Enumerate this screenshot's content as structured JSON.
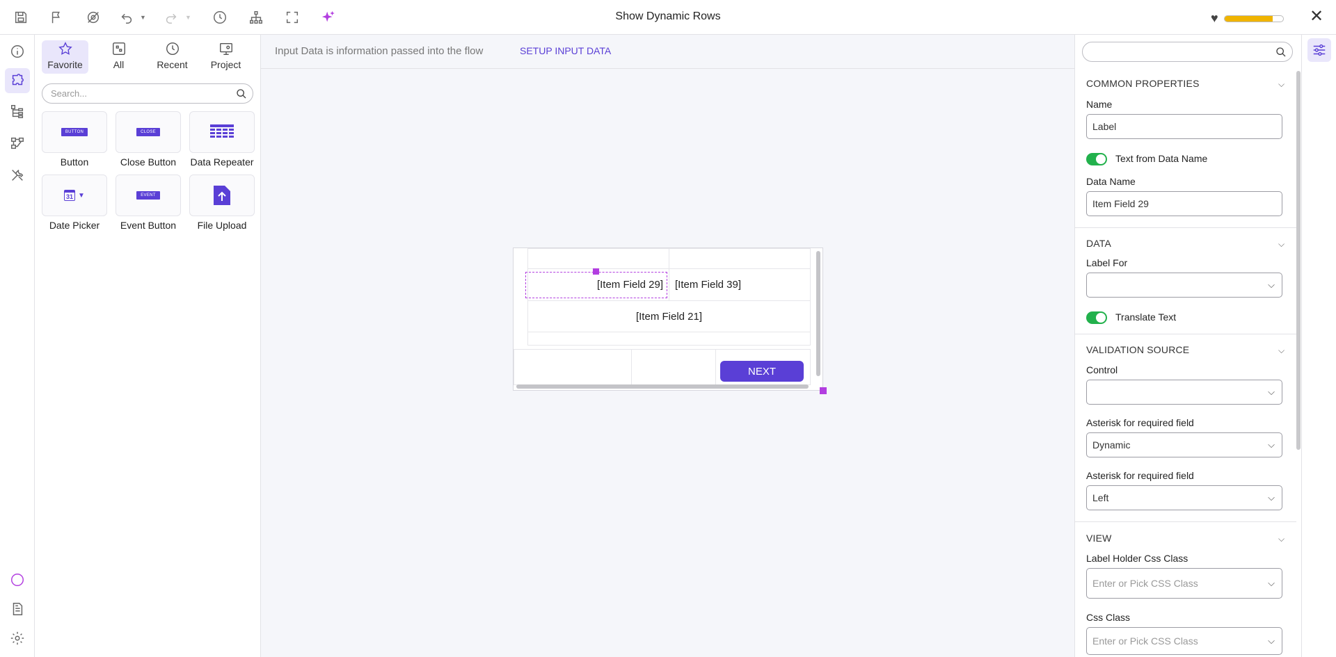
{
  "window": {
    "title": "Show Dynamic Rows"
  },
  "toolbar": {
    "icons": [
      "save-icon",
      "flag-icon",
      "settings-off-icon",
      "undo-icon",
      "redo-icon",
      "history-icon",
      "hierarchy-icon",
      "fullscreen-icon",
      "ai-sparkle-icon"
    ],
    "health_level": 0.82
  },
  "left_rail": {
    "icons": [
      "info-icon",
      "components-icon",
      "tree-icon",
      "flow-icon",
      "tools-icon",
      "chat-icon",
      "document-icon",
      "settings-gear-icon"
    ]
  },
  "toolbox": {
    "tabs": [
      {
        "label": "Favorite",
        "icon": "star-icon"
      },
      {
        "label": "All",
        "icon": "puzzle-icon"
      },
      {
        "label": "Recent",
        "icon": "clock-icon"
      },
      {
        "label": "Project",
        "icon": "project-icon"
      }
    ],
    "search_placeholder": "Search...",
    "items": [
      {
        "label": "Button",
        "badge": "BUTTON",
        "icon": "button-icon"
      },
      {
        "label": "Close Button",
        "badge": "CLOSE",
        "icon": "close-button-icon"
      },
      {
        "label": "Data Repeater",
        "icon": "data-repeater-icon"
      },
      {
        "label": "Date Picker",
        "badge": "31",
        "icon": "date-picker-icon"
      },
      {
        "label": "Event Button",
        "badge": "EVENT",
        "icon": "event-button-icon"
      },
      {
        "label": "File Upload",
        "icon": "file-upload-icon"
      }
    ]
  },
  "canvas": {
    "info_text": "Input Data is information passed into the flow",
    "info_link": "SETUP INPUT DATA",
    "cells": {
      "field29": "[Item Field 29]",
      "field39": "[Item Field 39]",
      "field21": "[Item Field 21]"
    },
    "next_button": "NEXT"
  },
  "properties": {
    "search_placeholder": "",
    "common": {
      "header": "COMMON PROPERTIES",
      "name_label": "Name",
      "name_value": "Label",
      "text_from_data_name": "Text from Data Name",
      "data_name_label": "Data Name",
      "data_name_value": "Item Field 29"
    },
    "data": {
      "header": "DATA",
      "label_for_label": "Label For",
      "label_for_value": "",
      "translate_text": "Translate Text"
    },
    "validation": {
      "header": "VALIDATION SOURCE",
      "control_label": "Control",
      "control_value": "",
      "asterisk_label_1": "Asterisk for required field",
      "asterisk_value_1": "Dynamic",
      "asterisk_label_2": "Asterisk for required field",
      "asterisk_value_2": "Left"
    },
    "view": {
      "header": "VIEW",
      "label_holder_label": "Label Holder Css Class",
      "label_holder_placeholder": "Enter or Pick CSS Class",
      "css_class_label": "Css Class",
      "css_class_placeholder": "Enter or Pick CSS Class"
    }
  },
  "colors": {
    "accent": "#5a3fd6",
    "selection": "#b23ee0",
    "toggle_on": "#22b14c",
    "health": "#f0b400"
  }
}
